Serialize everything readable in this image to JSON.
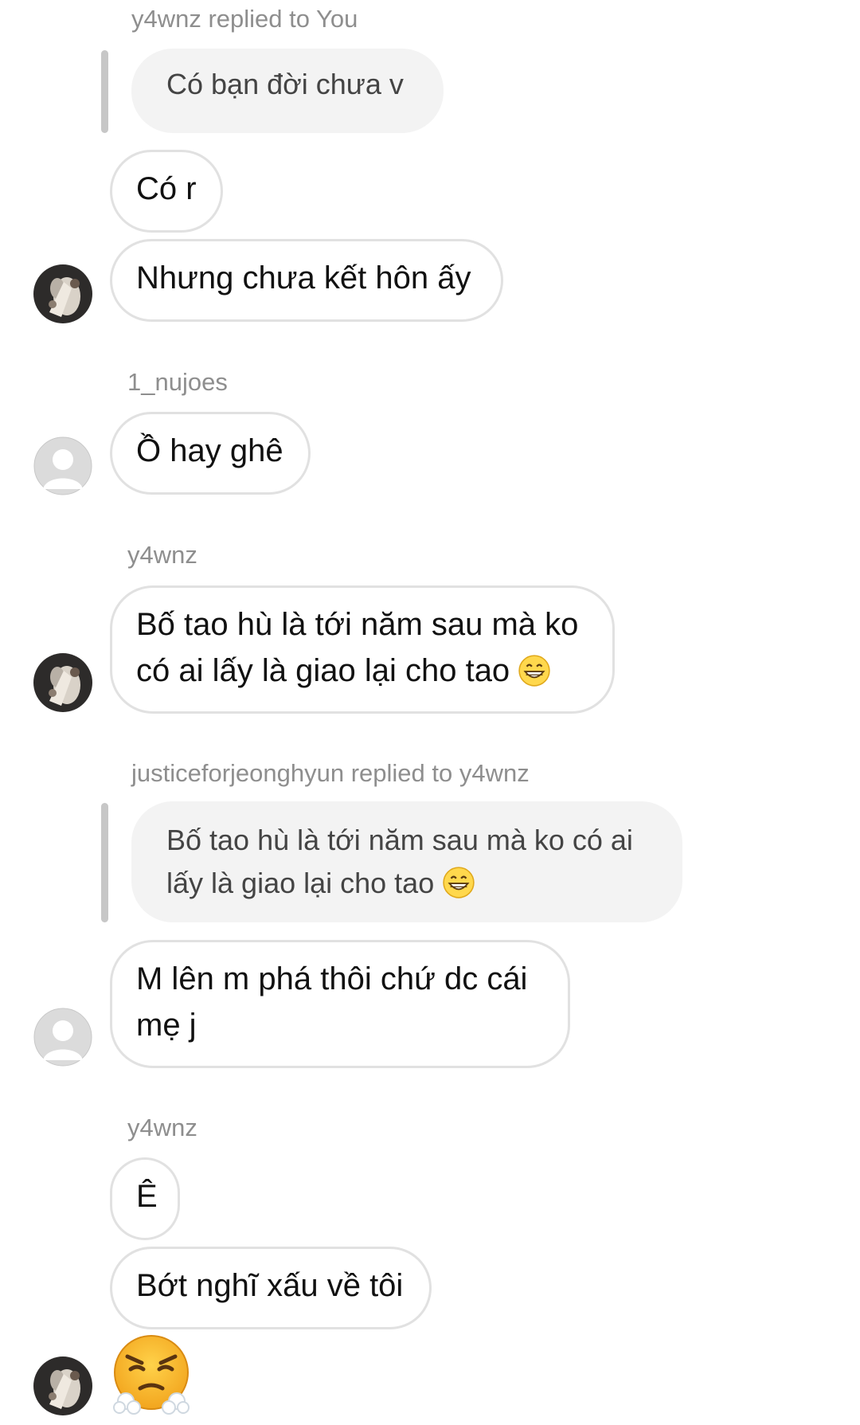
{
  "messages": {
    "m1_reply_label": "y4wnz replied to You",
    "m1_quote": "Có bạn đời chưa v",
    "m2": "Có r",
    "m3": "Nhưng chưa kết hôn ấy",
    "m4_sender": "1_nujoes",
    "m4": "Ồ hay ghê",
    "m5_sender": "y4wnz",
    "m5_line1": "Bố tao hù là tới năm sau mà ko",
    "m5_line2": "có ai lấy là giao lại cho tao",
    "m6_reply_label": "justiceforjeonghyun replied to y4wnz",
    "m6_quote_line1": "Bố tao hù là tới năm sau mà ko có ai",
    "m6_quote_line2": "lấy là giao lại cho tao",
    "m6_line1": "M lên m phá thôi chứ dc cái",
    "m6_line2": "mẹ j",
    "m7_sender": "y4wnz",
    "m7": "Ê",
    "m8": "Bớt nghĩ xấu về tôi"
  },
  "icons": {
    "grin": "grinning-face-icon",
    "steam": "face-with-steam-from-nose-icon",
    "avatar_photo": "profile-photo-avatar",
    "avatar_default": "default-user-avatar"
  },
  "colors": {
    "meta_text": "#8e8e8e",
    "bubble_border": "#e1e1e1",
    "quote_bg": "#f3f3f3",
    "reply_bar": "#c7c7c7"
  }
}
